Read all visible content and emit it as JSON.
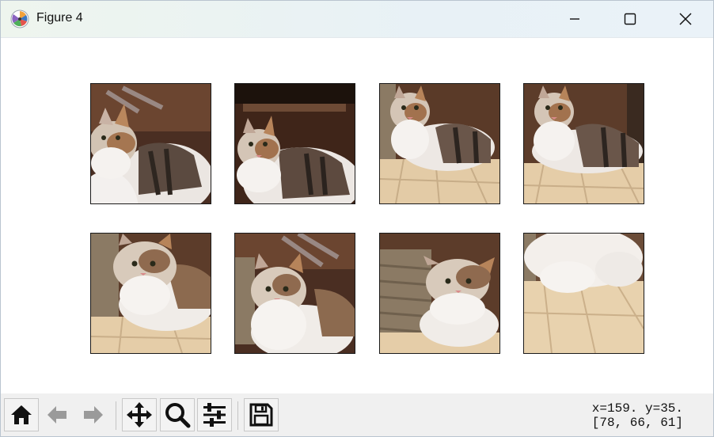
{
  "window": {
    "title": "Figure 4",
    "app_icon": "matplotlib-icon",
    "controls": [
      {
        "name": "minimize-button",
        "icon": "minimize-icon"
      },
      {
        "name": "maximize-button",
        "icon": "maximize-icon"
      },
      {
        "name": "close-button",
        "icon": "close-icon"
      }
    ]
  },
  "figure": {
    "grid": {
      "rows": 2,
      "cols": 4
    },
    "images": [
      {
        "subject": "cat-crop-1"
      },
      {
        "subject": "cat-crop-2"
      },
      {
        "subject": "cat-crop-3"
      },
      {
        "subject": "cat-crop-4"
      },
      {
        "subject": "cat-crop-5"
      },
      {
        "subject": "cat-crop-6"
      },
      {
        "subject": "cat-crop-7"
      },
      {
        "subject": "cat-crop-8"
      }
    ]
  },
  "toolbar": {
    "buttons": [
      {
        "name": "home-button",
        "icon": "home-icon"
      },
      {
        "name": "back-button",
        "icon": "back-arrow-icon"
      },
      {
        "name": "forward-button",
        "icon": "forward-arrow-icon"
      },
      {
        "name": "pan-button",
        "icon": "move-icon"
      },
      {
        "name": "zoom-button",
        "icon": "magnifier-icon"
      },
      {
        "name": "configure-subplots-button",
        "icon": "sliders-icon"
      },
      {
        "name": "save-button",
        "icon": "floppy-disk-icon"
      }
    ],
    "coords_line1": "x=159. y=35.",
    "coords_line2": "[78, 66, 61]"
  },
  "colors": {
    "titlebar": "#eaf2f6",
    "toolbar": "#f0f0f0",
    "tile_border": "#1a1a1a"
  }
}
